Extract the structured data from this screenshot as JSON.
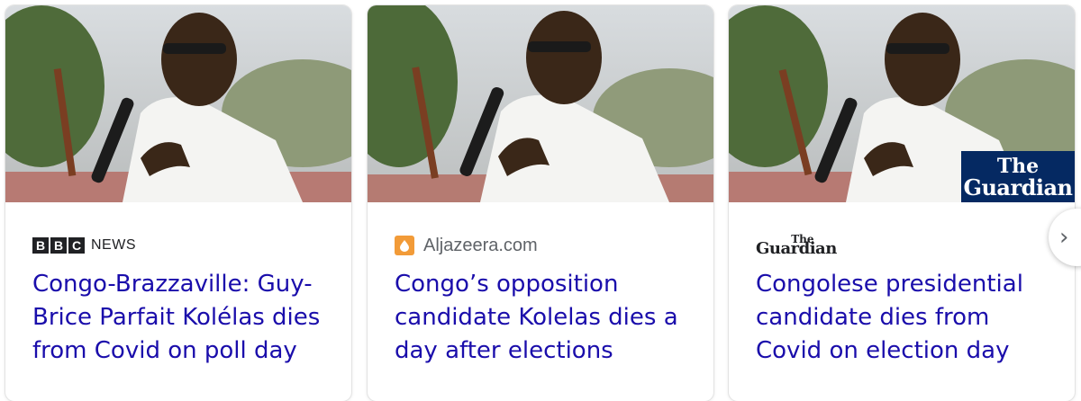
{
  "cards": [
    {
      "source": "NEWS",
      "source_logo": "bbc-news-logo",
      "bbc_letters": [
        "B",
        "B",
        "C"
      ],
      "headline": "Congo-Brazzaville: Guy-Brice Parfait Kolélas dies from Covid on poll day"
    },
    {
      "source": "Aljazeera.com",
      "source_logo": "aljazeera-icon",
      "headline": "Congo’s opposition candidate Kolelas dies a day after elections"
    },
    {
      "source_logo": "guardian-logo",
      "guardian_the": "The",
      "guardian_name": "Guardian",
      "badge_the": "The",
      "badge_name": "Guardian",
      "headline": "Congolese presidential candidate dies from Covid on election day"
    }
  ],
  "next_button": {
    "icon": "chevron-right-icon",
    "glyph": "›"
  },
  "colors": {
    "headline": "#1a0dab",
    "source": "#5f6368",
    "guardian_blue": "#052962",
    "aljazeera_orange": "#f29b38"
  }
}
